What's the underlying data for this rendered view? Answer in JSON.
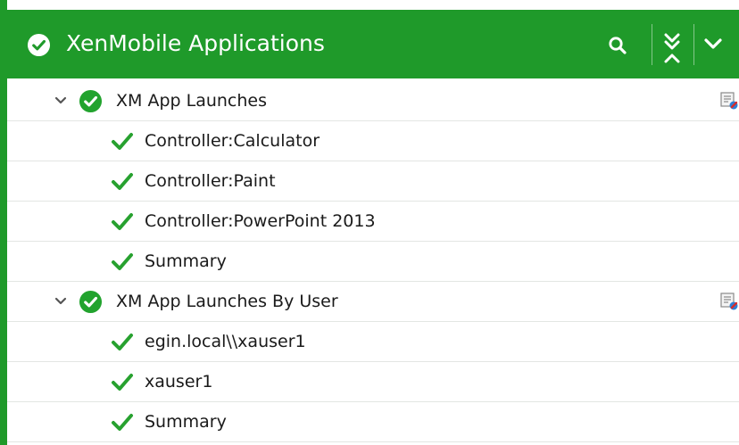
{
  "header": {
    "title": "XenMobile Applications",
    "bg_color": "#1f9a2a",
    "status_icon": "check-circle-icon",
    "search_icon": "search-icon",
    "collapse_all_icon": "collapse-all-icon",
    "menu_icon": "chevron-down-icon"
  },
  "tree": {
    "groups": [
      {
        "label": "XM App Launches",
        "expanded": true,
        "children": [
          {
            "label": "Controller:Calculator"
          },
          {
            "label": "Controller:Paint"
          },
          {
            "label": "Controller:PowerPoint 2013"
          },
          {
            "label": "Summary"
          }
        ]
      },
      {
        "label": "XM App Launches By User",
        "expanded": true,
        "children": [
          {
            "label": "egin.local\\\\xauser1"
          },
          {
            "label": "xauser1"
          },
          {
            "label": "Summary"
          }
        ]
      }
    ]
  }
}
